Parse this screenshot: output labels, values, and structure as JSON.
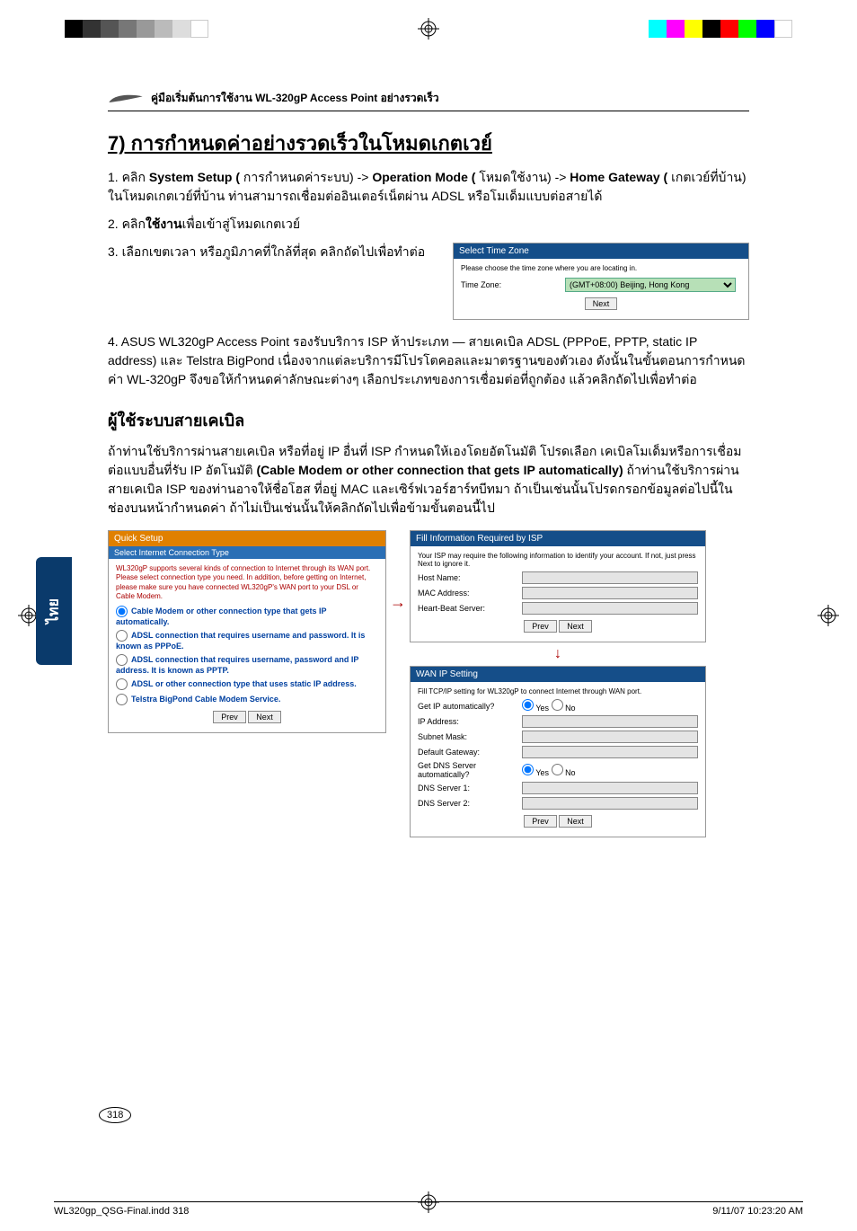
{
  "sideTab": "ไทย",
  "header": "คู่มือเริ่มต้นการใช้งาน WL-320gP Access Point อย่างรวดเร็ว",
  "sectionTitle": "7) การกำหนดค่าอย่างรวดเร็วในโหมดเกตเวย์",
  "step1_prefix": "1. คลิก ",
  "step1_b1": "System Setup (",
  "step1_t1": "การกำหนดค่าระบบ) -> ",
  "step1_b2": "Operation Mode (",
  "step1_t2": "โหมดใช้งาน) -> ",
  "step1_b3": "Home Gateway (",
  "step1_t3": "เกตเวย์ที่บ้าน) ในโหมดเกตเวย์ที่บ้าน ท่านสามารถเชื่อมต่ออินเตอร์เน็ตผ่าน ADSL หรือโมเด็มแบบต่อสายได้",
  "step2_prefix": "2. คลิก",
  "step2_b": "ใช้งาน",
  "step2_suffix": "เพื่อเข้าสู่โหมดเกตเวย์",
  "step3": "3. เลือกเขตเวลา หรือภูมิภาคที่ใกล้ที่สุด คลิกถัดไปเพื่อทำต่อ",
  "step4": "4. ASUS WL320gP Access Point รองรับบริการ ISP ห้าประเภท — สายเคเบิล ADSL (PPPoE, PPTP, static IP address) และ Telstra BigPond เนื่องจากแต่ละบริการมีโปรโตคอลและมาตรฐานของตัวเอง ดังนั้นในขั้นตอนการกำหนดค่า WL-320gP จึงขอให้กำหนดค่าลักษณะต่างๆ เลือกประเภทของการเชื่อมต่อที่ถูกต้อง แล้วคลิกถัดไปเพื่อทำต่อ",
  "subheading": "ผู้ใช้ระบบสายเคเบิล",
  "cable_p1": "ถ้าท่านใช้บริการผ่านสายเคเบิล หรือที่อยู่ IP อื่นที่ ISP กำหนดให้เองโดยอัตโนมัติ โปรดเลือก เคเบิลโมเด็มหรือการเชื่อมต่อแบบอื่นที่รับ IP อัตโนมัติ ",
  "cable_b1": "(Cable Modem or other connection that gets IP automatically)",
  "cable_p2": " ถ้าท่านใช้บริการผ่านสายเคเบิล ISP ของท่านอาจให้ชื่อโฮส ที่อยู่ MAC และเซิร์ฟเวอร์ฮาร์ทบีทมา ถ้าเป็นเช่นนั้นโปรดกรอกข้อมูลต่อไปนี้ในช่องบนหน้ากำหนดค่า ถ้าไม่เป็นเช่นนั้นให้คลิกถัดไปเพื่อข้ามขั้นตอนนี้ไป",
  "timezone": {
    "title": "Select Time Zone",
    "instruction": "Please choose the time zone where you are locating in.",
    "label": "Time Zone:",
    "value": "(GMT+08:00) Beijing, Hong Kong",
    "next": "Next"
  },
  "quicksetup": {
    "title": "Quick Setup",
    "subtitle": "Select Internet Connection Type",
    "desc": "WL320gP supports several kinds of connection to Internet through its WAN port. Please select connection type you need. In addition, before getting on Internet, please make sure you have connected WL320gP's WAN port to your DSL or Cable Modem.",
    "opt1": "Cable Modem or other connection type that gets IP automatically.",
    "opt2": "ADSL connection that requires username and password. It is known as PPPoE.",
    "opt3": "ADSL connection that requires username, password and IP address. It is known as PPTP.",
    "opt4": "ADSL or other connection type that uses static IP address.",
    "opt5": "Telstra BigPond Cable Modem Service.",
    "prev": "Prev",
    "next": "Next"
  },
  "ispinfo": {
    "title": "Fill Information Required by ISP",
    "desc": "Your ISP may require the following information to identify your account. If not, just press Next to ignore it.",
    "host": "Host Name:",
    "mac": "MAC Address:",
    "hb": "Heart-Beat Server:",
    "prev": "Prev",
    "next": "Next"
  },
  "wanip": {
    "title": "WAN IP Setting",
    "desc": "Fill TCP/IP setting for WL320gP to connect Internet through WAN port.",
    "getip": "Get IP automatically?",
    "ip": "IP Address:",
    "mask": "Subnet Mask:",
    "gw": "Default Gateway:",
    "getdns": "Get DNS Server automatically?",
    "dns1": "DNS Server 1:",
    "dns2": "DNS Server 2:",
    "yes": "Yes",
    "no": "No",
    "prev": "Prev",
    "next": "Next"
  },
  "pageNumber": "318",
  "footerLeft": "WL320gp_QSG-Final.indd   318",
  "footerRight": "9/11/07   10:23:20 AM"
}
